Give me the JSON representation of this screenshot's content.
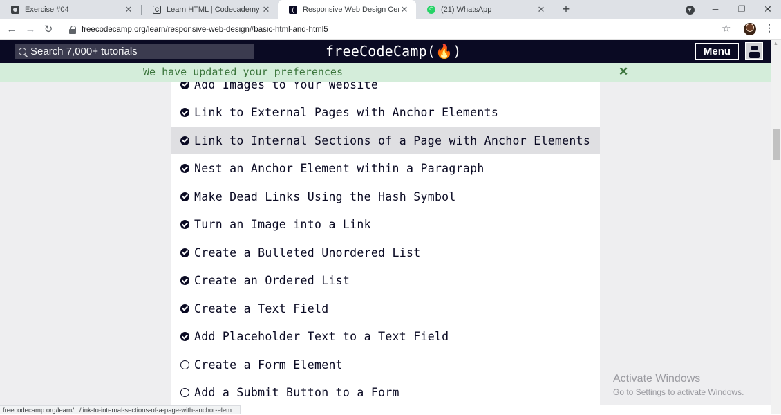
{
  "browser": {
    "tabs": [
      {
        "title": "Exercise #04",
        "icon": "document-icon"
      },
      {
        "title": "Learn HTML | Codecademy",
        "icon": "codecademy-icon"
      },
      {
        "title": "Responsive Web Design Certificat",
        "icon": "freecodecamp-icon",
        "active": true
      },
      {
        "title": "(21) WhatsApp",
        "icon": "whatsapp-icon"
      }
    ],
    "url": "freecodecamp.org/learn/responsive-web-design#basic-html-and-html5",
    "status_url": "freecodecamp.org/learn/.../link-to-internal-sections-of-a-page-with-anchor-elem...",
    "new_tab": "+",
    "close_glyph": "✕"
  },
  "fcc_nav": {
    "search_placeholder": "Search 7,000+ tutorials",
    "logo": "freeCodeCamp(🔥)",
    "menu_label": "Menu"
  },
  "flash": {
    "message": "We have updated your preferences",
    "close": "✕"
  },
  "lessons": [
    {
      "title": "Add Images to Your Website",
      "completed": true
    },
    {
      "title": "Link to External Pages with Anchor Elements",
      "completed": true
    },
    {
      "title": "Link to Internal Sections of a Page with Anchor Elements",
      "completed": true,
      "highlighted": true
    },
    {
      "title": "Nest an Anchor Element within a Paragraph",
      "completed": true
    },
    {
      "title": "Make Dead Links Using the Hash Symbol",
      "completed": true
    },
    {
      "title": "Turn an Image into a Link",
      "completed": true
    },
    {
      "title": "Create a Bulleted Unordered List",
      "completed": true
    },
    {
      "title": "Create an Ordered List",
      "completed": true
    },
    {
      "title": "Create a Text Field",
      "completed": true
    },
    {
      "title": "Add Placeholder Text to a Text Field",
      "completed": true
    },
    {
      "title": "Create a Form Element",
      "completed": false
    },
    {
      "title": "Add a Submit Button to a Form",
      "completed": false
    }
  ],
  "watermark": {
    "title": "Activate Windows",
    "subtitle": "Go to Settings to activate Windows."
  },
  "colors": {
    "fcc_dark": "#0a0a23",
    "flash_bg": "#d4edda",
    "flash_text": "#3c763d",
    "highlight_row": "#dfdfe2"
  }
}
